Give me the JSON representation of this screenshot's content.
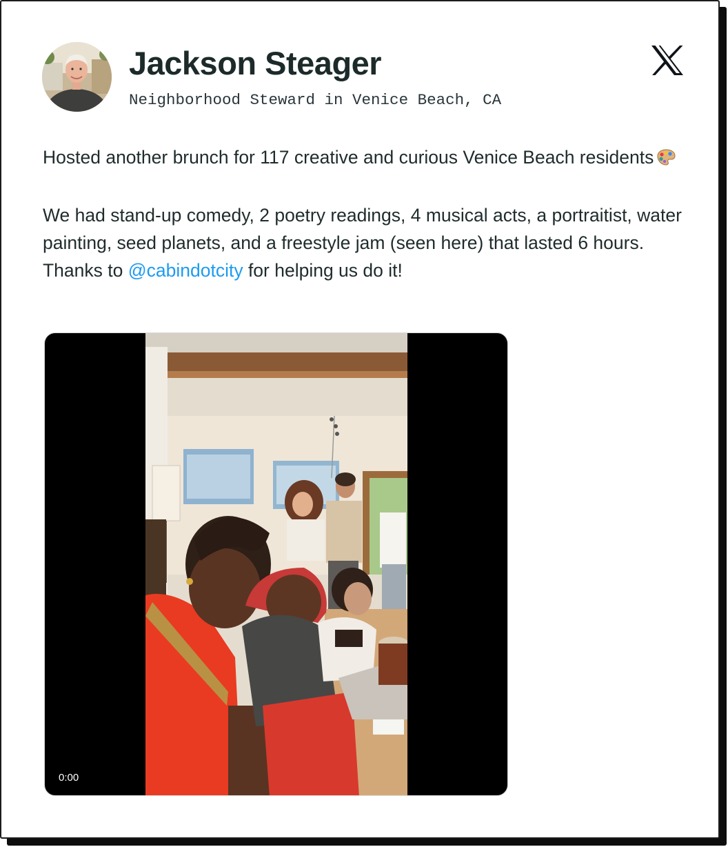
{
  "author": {
    "name": "Jackson Steager",
    "subtitle": "Neighborhood Steward in Venice Beach, CA"
  },
  "platform_icon": "x-logo-icon",
  "post": {
    "paragraph1": "Hosted another brunch for 117 creative and curious Venice Beach residents",
    "paragraph1_emoji": "artist-palette-icon",
    "paragraph2_before": "We had stand-up comedy, 2 poetry readings, 4 musical acts, a portraitist, water painting, seed planets, and a freestyle jam (seen here) that lasted 6 hours. Thanks to ",
    "mention": "@cabindotcity",
    "paragraph2_after": " for helping us do it!"
  },
  "video": {
    "time": "0:00"
  },
  "colors": {
    "mention": "#1d9bf0",
    "text": "#1f2b2c",
    "card_border": "#1c1c1c"
  }
}
